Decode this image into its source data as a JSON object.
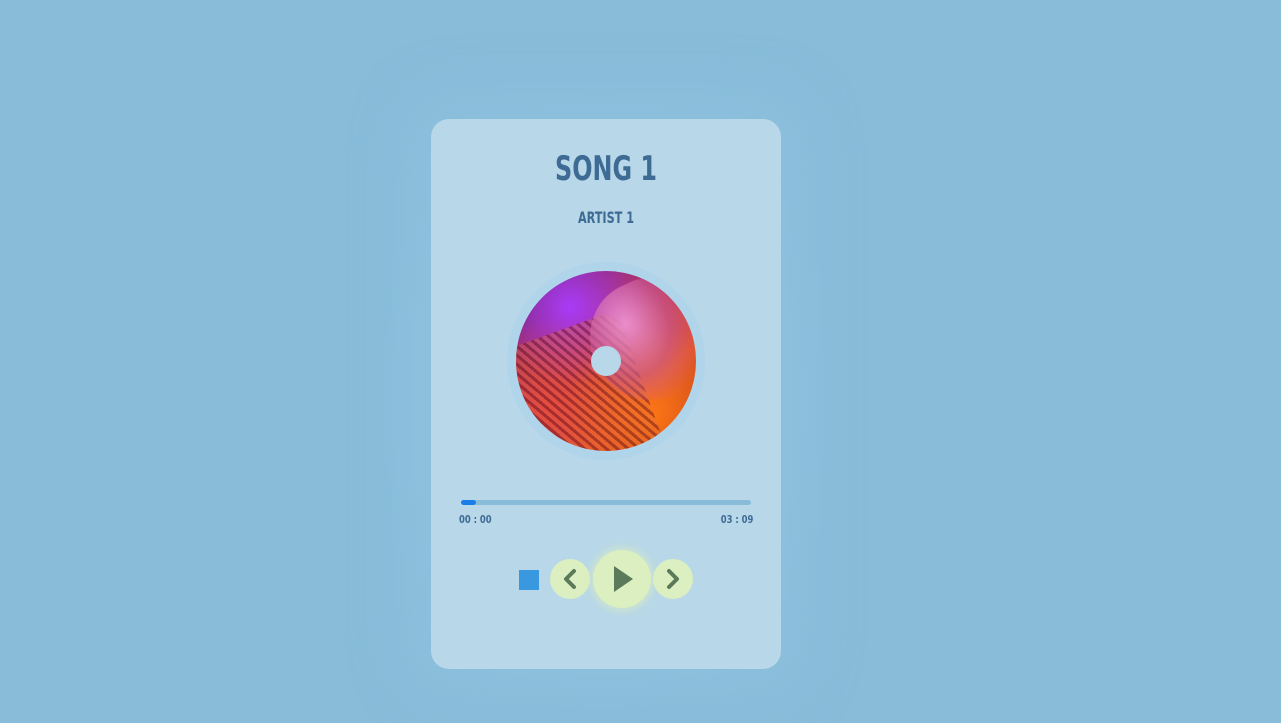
{
  "player": {
    "song_title": "SONG 1",
    "artist": "ARTIST 1",
    "current_time": "00 : 00",
    "duration": "03 : 09",
    "progress": 0.05
  },
  "icons": {
    "stop": "stop-icon",
    "prev": "chevron-left-icon",
    "play": "play-icon",
    "next": "chevron-right-icon"
  },
  "colors": {
    "background": "#88bcd9",
    "card": "#b8d7e8",
    "text": "#3e6b94",
    "progress_fill": "#1a7ee8",
    "stop_button": "#3a98de",
    "control_button": "#dcefc0",
    "control_icon": "#5a7a5a"
  }
}
